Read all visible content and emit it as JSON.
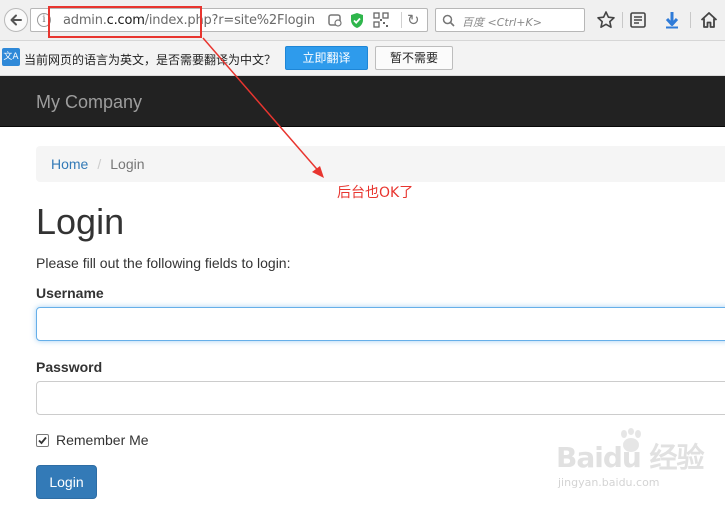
{
  "browser": {
    "url_prefix": "admin.",
    "url_domain": "c.com",
    "url_path": "/index.php",
    "url_query": "?r=site%2Flogin",
    "search_placeholder": "百度 <Ctrl+K>"
  },
  "translate_bar": {
    "message": "当前网页的语言为英文，是否需要翻译为中文？",
    "translate_button": "立即翻译",
    "dismiss_button": "暂不需要"
  },
  "navbar": {
    "brand": "My Company"
  },
  "breadcrumb": {
    "home": "Home",
    "separator": "/",
    "current": "Login"
  },
  "form": {
    "title": "Login",
    "intro": "Please fill out the following fields to login:",
    "username_label": "Username",
    "username_value": "",
    "password_label": "Password",
    "password_value": "",
    "remember_label": "Remember Me",
    "remember_checked": true,
    "submit_label": "Login"
  },
  "annotation": {
    "text": "后台也OK了",
    "color": "#e8352f"
  },
  "watermark": {
    "main": "Baidu 经验",
    "sub": "jingyan.baidu.com"
  },
  "colors": {
    "navbar_bg": "#222222",
    "primary": "#337ab7",
    "translate_button": "#2e9bec"
  }
}
